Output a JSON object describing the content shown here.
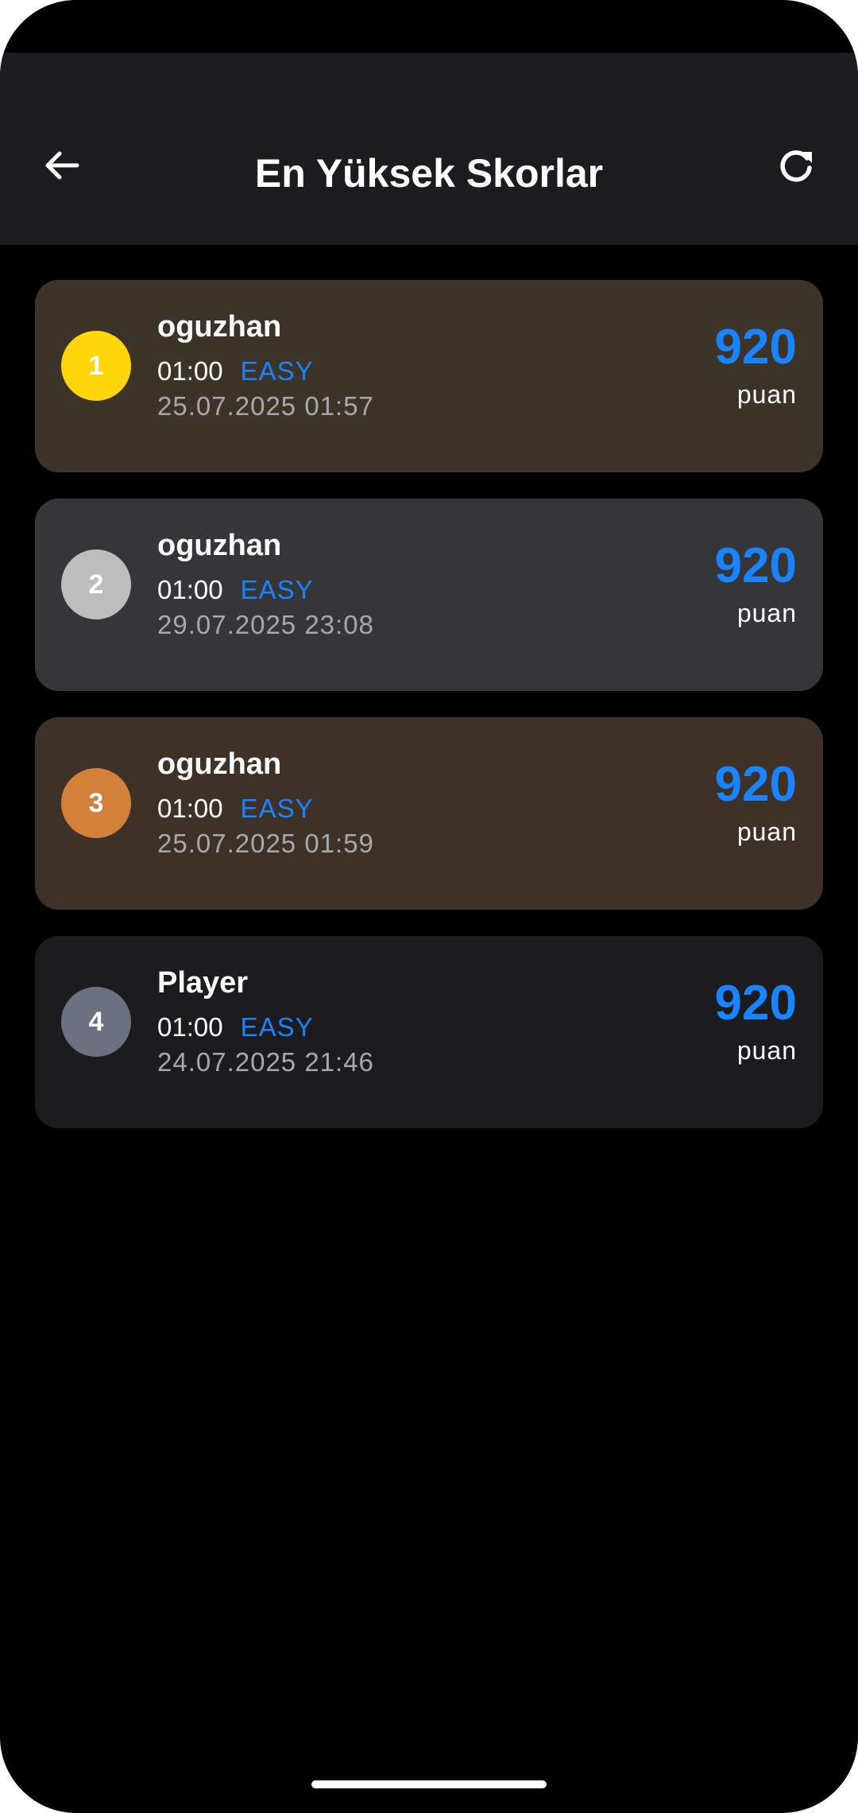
{
  "header": {
    "title": "En Yüksek Skorlar",
    "back_icon": "arrow-left-icon",
    "refresh_icon": "refresh-icon"
  },
  "theme": {
    "accent": "#1a84ff",
    "app_bar_bg": "#1c1c1e",
    "screen_bg": "#000000"
  },
  "scores": [
    {
      "rank": "1",
      "name": "oguzhan",
      "duration": "01:00",
      "difficulty": "EASY",
      "date": "25.07.2025 01:57",
      "score": "920",
      "unit": "puan",
      "badge_color": "#ffd60a",
      "card_color": "#3c3428"
    },
    {
      "rank": "2",
      "name": "oguzhan",
      "duration": "01:00",
      "difficulty": "EASY",
      "date": "29.07.2025 23:08",
      "score": "920",
      "unit": "puan",
      "badge_color": "#bdbdbd",
      "card_color": "#363638"
    },
    {
      "rank": "3",
      "name": "oguzhan",
      "duration": "01:00",
      "difficulty": "EASY",
      "date": "25.07.2025 01:59",
      "score": "920",
      "unit": "puan",
      "badge_color": "#d2803a",
      "card_color": "#3d3128"
    },
    {
      "rank": "4",
      "name": "Player",
      "duration": "01:00",
      "difficulty": "EASY",
      "date": "24.07.2025 21:46",
      "score": "920",
      "unit": "puan",
      "badge_color": "#6b7181",
      "card_color": "#1c1c1e"
    }
  ]
}
